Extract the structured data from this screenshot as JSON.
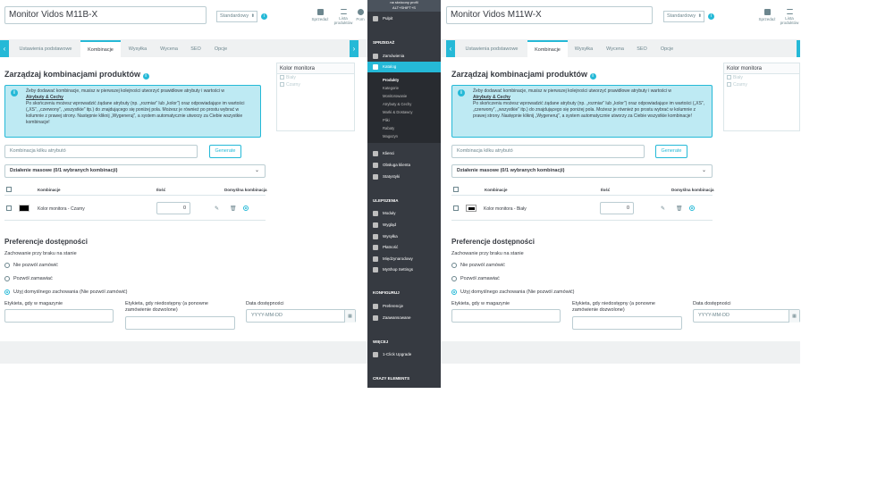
{
  "left": {
    "title": "Monitor Vidos M11B-X",
    "select": "Standardowy",
    "toolbar": [
      "Sprzedaż",
      "Lista produktów",
      "Pom"
    ],
    "tabs": [
      "Ustawienia podstawowe",
      "Kombinacje",
      "Wysyłka",
      "Wycena",
      "SEO",
      "Opcje"
    ],
    "section_title": "Zarządzaj kombinacjami produktów",
    "info_lines": [
      "Żeby dodawać kombinacje, musisz w pierwszej kolejności utworzyć prawidłowe atrybuty i wartości w",
      "Atrybuty & Cechy",
      "Po skończeniu możesz wprowadzić żądane atrybuty (np. „rozmiar” lub „kolor”) oraz odpowiadające im wartości („XS”, „czerwony”, „wszystkie” itp.) do znajdującego się poniżej pola. Możesz je również po prostu wybrać w kolumnie z prawej strony. Następnie kliknij „Wygeneruj”, a system automatycznie utworzy za Ciebie wszystkie kombinacje!"
    ],
    "attr_box_title": "Kolor monitora",
    "attr_values": [
      "Biały",
      "Czarny"
    ],
    "generate_placeholder": "Kombinacja kilku atrybutó",
    "generate_button": "Generate",
    "bulk": "Działenie masowe (0/1 wybranych kombinacji)",
    "col_headers": [
      "Kombinacje",
      "Ilość",
      "Domyślna kombinacja"
    ],
    "row": {
      "name": "Kolor monitora - Czarny",
      "qty": "0"
    },
    "pref_title": "Preferencje dostępności",
    "stock_label": "Zachowanie przy braku na stanie",
    "radios": [
      "Nie pozwól zamówić",
      "Pozwól zamawiać",
      "Użyj domyślnego zachowania (Nie pozwól zamówić)"
    ],
    "f1_label": "Etykieta, gdy w magazynie",
    "f2_label": "Etykieta, gdy niedostępny (a ponowne zamówienie dozwolone)",
    "f3_label": "Data dostępności",
    "date_placeholder": "YYYY-MM-DD"
  },
  "right": {
    "title": "Monitor Vidos M11W-X",
    "select": "Standardowy",
    "toolbar": [
      "Sprzedaż",
      "Lista produktów"
    ],
    "tabs": [
      "Ustawienia podstawowe",
      "Kombinacje",
      "Wysyłka",
      "Wycena",
      "SEO",
      "Opcje"
    ],
    "section_title": "Zarządzaj kombinacjami produktów",
    "info_lines": [
      "Żeby dodawać kombinacje, musisz w pierwszej kolejności utworzyć prawidłowe atrybuty i wartości w",
      "Atrybuty & Cechy",
      "Po skończeniu możesz wprowadzić żądane atrybuty (np. „rozmiar” lub „kolor”) oraz odpowiadające im wartości („XS”, „czerwony”, „wszystkie” itp.) do znajdującego się poniżej pola. Możesz je również po prostu wybrać w kolumnie z prawej strony. Następnie kliknij „Wygeneruj”, a system automatycznie utworzy za Ciebie wszystkie kombinacje!"
    ],
    "attr_box_title": "Kolor monitora",
    "attr_values": [
      "Biały",
      "Czarny"
    ],
    "generate_placeholder": "Kombinacja kilku atrybutó",
    "generate_button": "Generate",
    "bulk": "Działenie masowe (0/1 wybranych kombinacji)",
    "col_headers": [
      "Kombinacje",
      "Ilość",
      "Domyślna kombinacja"
    ],
    "row": {
      "name": "Kolor monitora - Biały",
      "qty": "0"
    },
    "pref_title": "Preferencje dostępności",
    "stock_label": "Zachowanie przy braku na stanie",
    "radios": [
      "Nie pozwól zamówić",
      "Pozwól zamawiać",
      "Użyj domyślnego zachowania (Nie pozwól zamówić)"
    ],
    "f1_label": "Etykieta, gdy w magazynie",
    "f2_label": "Etykieta, gdy niedostępny (a ponowne zamówienie dozwolone)",
    "f3_label": "Data dostępności",
    "date_placeholder": "YYYY-MM-DD"
  },
  "sidebar": {
    "top_hint": [
      "na skrócony profil",
      "ALT+SHIFT+S"
    ],
    "quick": "Pulpit",
    "sec_sprzedaz": "SPRZEDAŻ",
    "items1": [
      "Zamówienia",
      "Katalog"
    ],
    "catalog_sub": [
      "Produkty",
      "Kategorie",
      "Monitorowanie",
      "Atrybuty & Cechy",
      "Marki & Dostawcy",
      "Pliki",
      "Rabaty",
      "Magazyn"
    ],
    "items2": [
      "Klienci",
      "Obsługa klienta",
      "Statystyki"
    ],
    "sec_ulepszenia": "ULEPSZENIA",
    "items3": [
      "Moduły",
      "Wygląd",
      "Wysyłka",
      "Płatność",
      "Międzynarodowy",
      "MyShop Settings"
    ],
    "sec_konfiguruj": "KONFIGURUJ",
    "items4": [
      "Preferencje",
      "Zaawansowane"
    ],
    "sec_wiecej": "WIĘCEJ",
    "items5": [
      "1-Click Upgrade"
    ],
    "sec_crazy": "CRAZY ELEMENTS"
  },
  "colors": {
    "accent": "#25b9d7",
    "sidebar": "#363a41",
    "info_bg": "#beeaf3"
  }
}
